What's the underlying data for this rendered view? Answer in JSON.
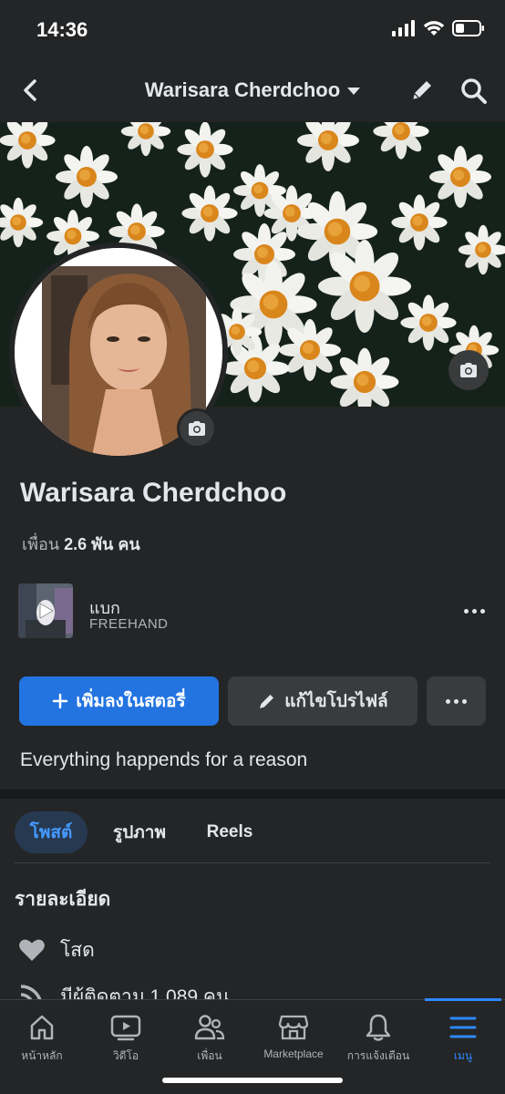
{
  "status_bar": {
    "time": "14:36"
  },
  "nav": {
    "title": "Warisara Cherdchoo"
  },
  "profile": {
    "name": "Warisara Cherdchoo",
    "friends_prefix": "เพื่อน",
    "friends_count": "2.6 พัน คน",
    "bio": "Everything happends for a reason"
  },
  "music": {
    "title": "แบก",
    "artist": "FREEHAND"
  },
  "buttons": {
    "add_story": "เพิ่มลงในสตอรี่",
    "edit_profile": "แก้ไขโปรไฟล์"
  },
  "tabs": [
    {
      "label": "โพสต์",
      "active": true
    },
    {
      "label": "รูปภาพ",
      "active": false
    },
    {
      "label": "Reels",
      "active": false
    }
  ],
  "details": {
    "title": "รายละเอียด",
    "relationship": "โสด",
    "followers": "มีผู้ติดตาม 1,089 คน"
  },
  "bottom_nav": [
    {
      "label": "หน้าหลัก",
      "icon": "home-icon"
    },
    {
      "label": "วิดีโอ",
      "icon": "video-icon"
    },
    {
      "label": "เพื่อน",
      "icon": "friends-icon"
    },
    {
      "label": "Marketplace",
      "icon": "marketplace-icon"
    },
    {
      "label": "การแจ้งเตือน",
      "icon": "bell-icon"
    },
    {
      "label": "เมนู",
      "icon": "menu-icon",
      "active": true
    }
  ],
  "colors": {
    "accent": "#2374e1",
    "background": "#242526",
    "active_tab_bg": "#263951"
  }
}
